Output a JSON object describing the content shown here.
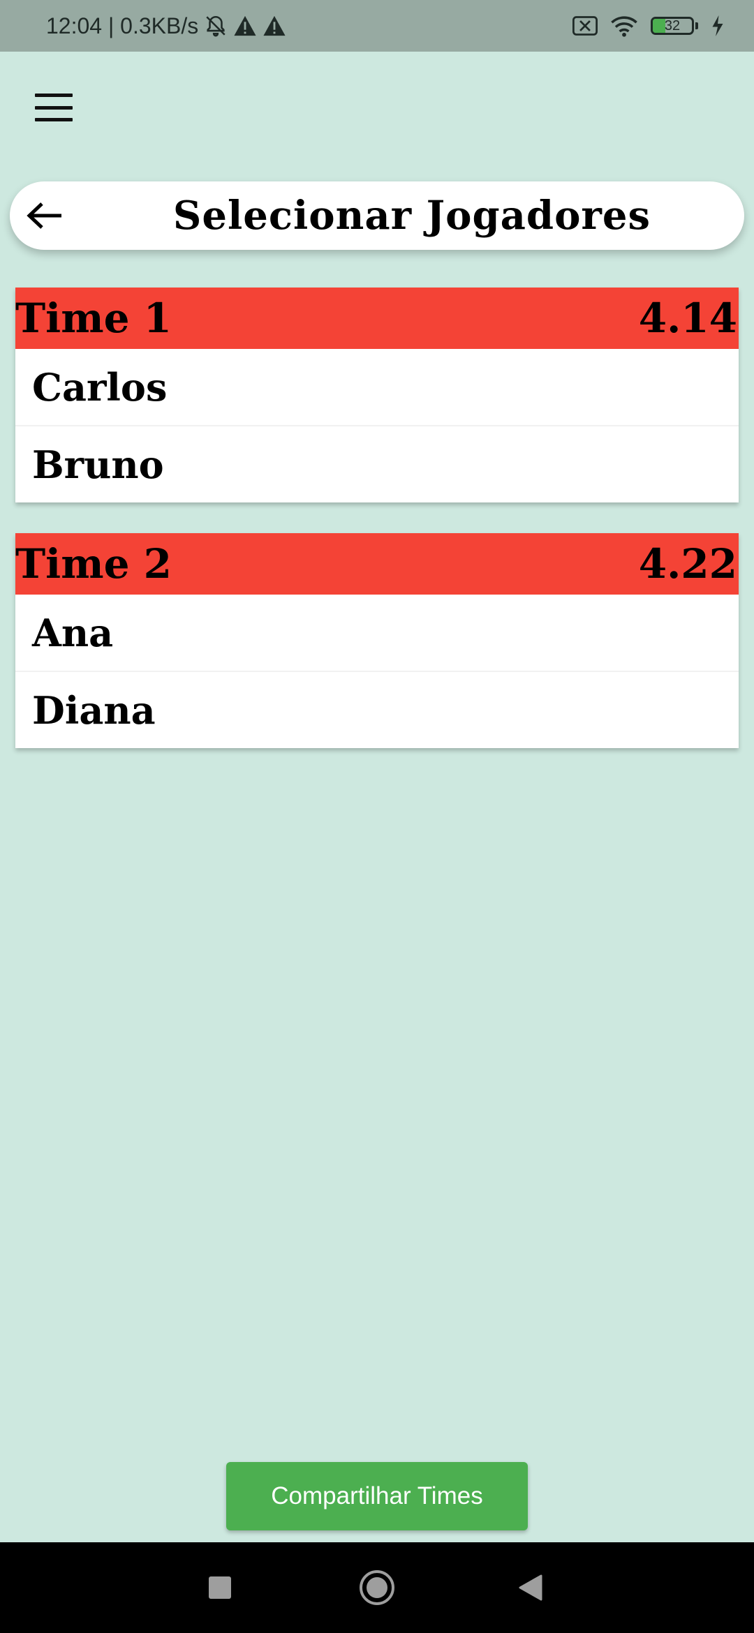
{
  "status_bar": {
    "text": "12:04 | 0.3KB/s",
    "battery": "32",
    "battery_level": 0.32,
    "battery_color": "#4caf50",
    "icons": [
      "alarm-off-icon",
      "warning-icon",
      "warning-icon",
      "no-sim-icon",
      "wifi-icon",
      "battery-icon",
      "charging-icon"
    ]
  },
  "header": {
    "title": "Selecionar Jogadores",
    "back_icon": "arrow-left-icon",
    "menu_icon": "hamburger-menu-icon"
  },
  "colors": {
    "background": "#cde8df",
    "team_header": "#f44336",
    "button": "#4caf50"
  },
  "teams": [
    {
      "name": "Time 1",
      "score": "4.14",
      "players": [
        "Carlos",
        "Bruno"
      ]
    },
    {
      "name": "Time 2",
      "score": "4.22",
      "players": [
        "Ana",
        "Diana"
      ]
    }
  ],
  "share_button": {
    "label": "Compartilhar Times"
  },
  "nav_bar": {
    "icons": [
      "recents-square-icon",
      "home-circle-icon",
      "back-triangle-icon"
    ]
  }
}
